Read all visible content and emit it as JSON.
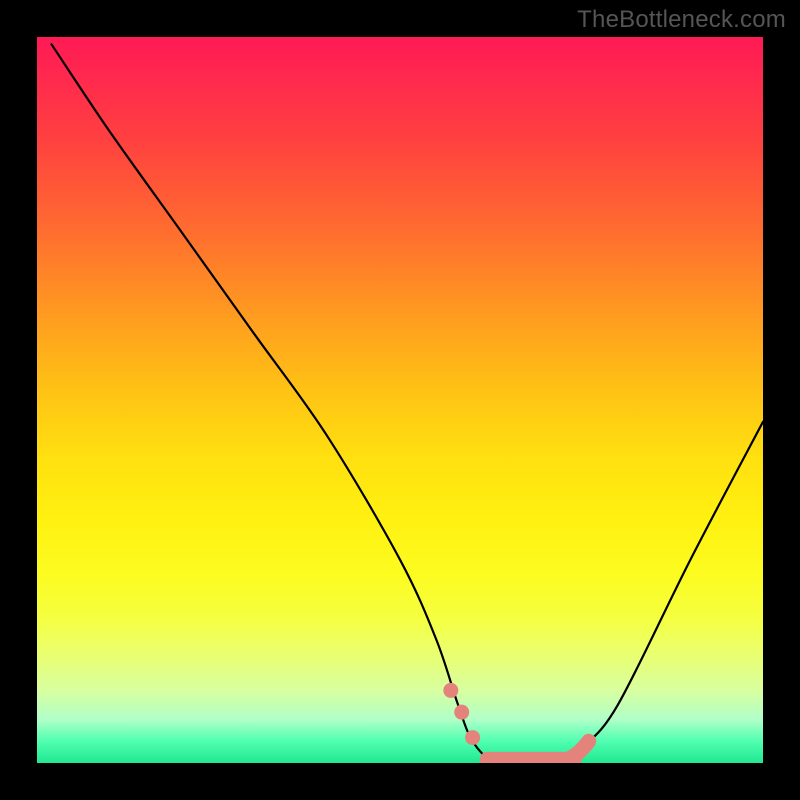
{
  "watermark": "TheBottleneck.com",
  "chart_data": {
    "type": "line",
    "title": "",
    "xlabel": "",
    "ylabel": "",
    "ylim": [
      0,
      100
    ],
    "xlim": [
      0,
      100
    ],
    "series": [
      {
        "name": "bottleneck-curve",
        "x": [
          2,
          10,
          20,
          30,
          40,
          50,
          55,
          58,
          60,
          63,
          66,
          70,
          73,
          75,
          80,
          90,
          100
        ],
        "values": [
          99,
          87,
          73,
          59,
          45,
          28,
          17,
          8,
          3,
          0,
          0,
          0,
          0,
          2,
          8,
          28,
          47
        ]
      }
    ],
    "highlight_region": {
      "x_start": 57,
      "x_end": 75,
      "note": "flat minimum band"
    },
    "gradient_stops": [
      {
        "pct": 0,
        "color": "#ff1a55"
      },
      {
        "pct": 6,
        "color": "#ff2a4d"
      },
      {
        "pct": 14,
        "color": "#ff4040"
      },
      {
        "pct": 26,
        "color": "#ff6a30"
      },
      {
        "pct": 38,
        "color": "#ff9a20"
      },
      {
        "pct": 48,
        "color": "#ffc015"
      },
      {
        "pct": 58,
        "color": "#ffe010"
      },
      {
        "pct": 66,
        "color": "#fff010"
      },
      {
        "pct": 74,
        "color": "#fcfc20"
      },
      {
        "pct": 80,
        "color": "#f5ff40"
      },
      {
        "pct": 85,
        "color": "#eaff70"
      },
      {
        "pct": 90,
        "color": "#d8ffa0"
      },
      {
        "pct": 94,
        "color": "#b0ffc8"
      },
      {
        "pct": 97,
        "color": "#50ffb0"
      },
      {
        "pct": 100,
        "color": "#20e890"
      }
    ],
    "colors": {
      "curve": "#000000",
      "highlight": "#e4837c",
      "border": "#000000"
    }
  }
}
